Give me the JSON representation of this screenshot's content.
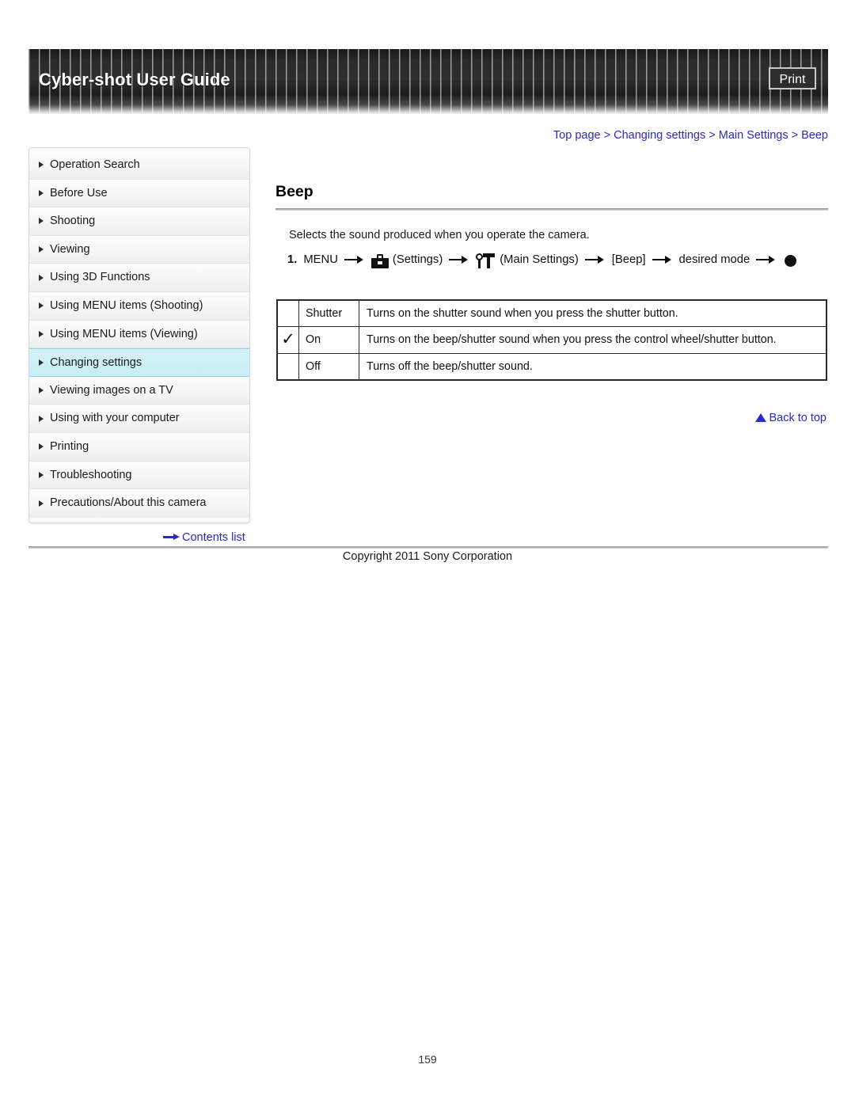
{
  "header": {
    "title": "Cyber-shot User Guide",
    "print_label": "Print"
  },
  "breadcrumb": {
    "full": "Top page > Changing settings > Main Settings > Beep",
    "items": [
      "Top page",
      "Changing settings",
      "Main Settings",
      "Beep"
    ],
    "separator": ">",
    "link_color": "#2b2bc0"
  },
  "sidebar": {
    "items": [
      {
        "label": "Operation Search",
        "active": false
      },
      {
        "label": "Before Use",
        "active": false
      },
      {
        "label": "Shooting",
        "active": false
      },
      {
        "label": "Viewing",
        "active": false
      },
      {
        "label": "Using 3D Functions",
        "active": false
      },
      {
        "label": "Using MENU items (Shooting)",
        "active": false
      },
      {
        "label": "Using MENU items (Viewing)",
        "active": false
      },
      {
        "label": "Changing settings",
        "active": true
      },
      {
        "label": "Viewing images on a TV",
        "active": false
      },
      {
        "label": "Using with your computer",
        "active": false
      },
      {
        "label": "Printing",
        "active": false
      },
      {
        "label": "Troubleshooting",
        "active": false
      },
      {
        "label": "Precautions/About this camera",
        "active": false
      }
    ],
    "contents_list_label": "Contents list",
    "active_highlight_color": "#cdeff6"
  },
  "main": {
    "title": "Beep",
    "intro": "Selects the sound produced when you operate the camera.",
    "step": {
      "number": "1.",
      "menu_label": "MENU",
      "settings_label": "(Settings)",
      "main_settings_label": "(Main Settings)",
      "beep_label": "[Beep]",
      "desired_mode_label": "desired mode",
      "settings_icon": "toolbox-icon",
      "main_settings_icon": "wrench-hammer-icon",
      "arrow_icon": "arrow-right-icon",
      "confirm_icon": "center-button-icon"
    },
    "table": {
      "rows": [
        {
          "checked": false,
          "check_mark": "",
          "mode": "Shutter",
          "description": "Turns on the shutter sound when you press the shutter button."
        },
        {
          "checked": true,
          "check_mark": "✓",
          "mode": "On",
          "description": "Turns on the beep/shutter sound when you press the control wheel/shutter button."
        },
        {
          "checked": false,
          "check_mark": "",
          "mode": "Off",
          "description": "Turns off the beep/shutter sound."
        }
      ]
    },
    "back_to_top_label": "Back to top"
  },
  "footer": {
    "copyright": "Copyright 2011 Sony Corporation",
    "page_number": "159"
  }
}
